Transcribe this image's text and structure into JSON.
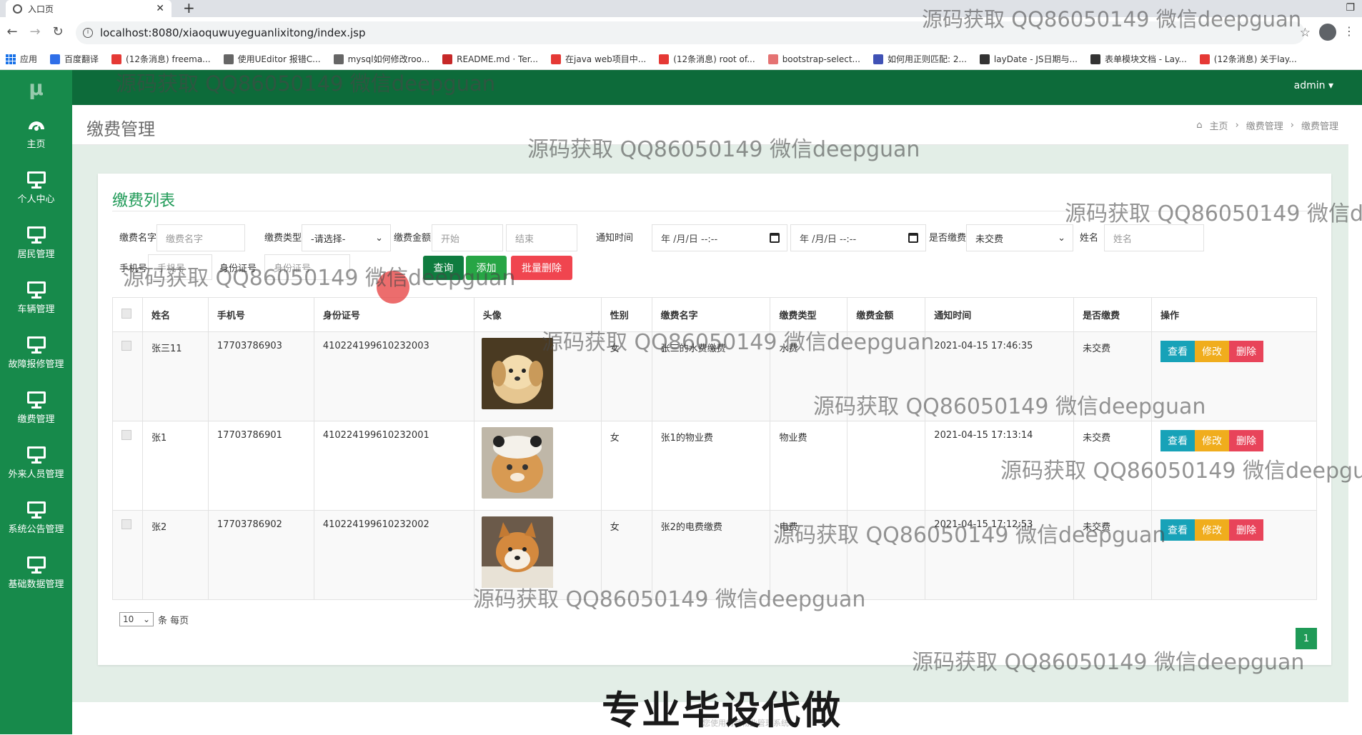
{
  "browser": {
    "tab_title": "入口页",
    "url": "localhost:8080/xiaoquwuyeguanlixitong/index.jsp",
    "bookmarks": [
      {
        "label": "应用",
        "color": "#1a73e8"
      },
      {
        "label": "百度翻译",
        "color": "#2f6fe8"
      },
      {
        "label": "(12条消息) freema...",
        "color": "#e53935"
      },
      {
        "label": "使用UEditor 报错C...",
        "color": "#666666"
      },
      {
        "label": "mysql如何修改roo...",
        "color": "#666666"
      },
      {
        "label": "README.md · Ter...",
        "color": "#c62828"
      },
      {
        "label": "在java web项目中...",
        "color": "#e53935"
      },
      {
        "label": "(12条消息) root of...",
        "color": "#e53935"
      },
      {
        "label": "bootstrap-select...",
        "color": "#e57373"
      },
      {
        "label": "如何用正则匹配: 2...",
        "color": "#3f51b5"
      },
      {
        "label": "layDate - JS日期与...",
        "color": "#333333"
      },
      {
        "label": "表单模块文档 - Lay...",
        "color": "#333333"
      },
      {
        "label": "(12条消息) 关于lay...",
        "color": "#e53935"
      }
    ]
  },
  "sidebar": {
    "logo": "μ",
    "items": [
      {
        "label": "主页",
        "icon": "dashboard-icon"
      },
      {
        "label": "个人中心",
        "icon": "monitor-icon"
      },
      {
        "label": "居民管理",
        "icon": "monitor-icon"
      },
      {
        "label": "车辆管理",
        "icon": "monitor-icon"
      },
      {
        "label": "故障报修管理",
        "icon": "monitor-icon"
      },
      {
        "label": "缴费管理",
        "icon": "monitor-icon"
      },
      {
        "label": "外来人员管理",
        "icon": "monitor-icon"
      },
      {
        "label": "系统公告管理",
        "icon": "monitor-icon"
      },
      {
        "label": "基础数据管理",
        "icon": "monitor-icon"
      }
    ]
  },
  "topbar": {
    "user": "admin ▾"
  },
  "page": {
    "title": "缴费管理",
    "breadcrumb": [
      "主页",
      "缴费管理",
      "缴费管理"
    ]
  },
  "card": {
    "title": "缴费列表"
  },
  "filters": {
    "name_label": "缴费名字",
    "name_placeholder": "缴费名字",
    "type_label": "缴费类型",
    "type_value": "-请选择-",
    "amount_label": "缴费金额",
    "amount_start": "开始",
    "amount_end": "结束",
    "time_label": "通知时间",
    "date_from": "年 /月/日 --:--",
    "date_to": "年 /月/日 --:--",
    "paid_label": "是否缴费",
    "paid_value": "未交费",
    "person_label": "姓名",
    "person_placeholder": "姓名",
    "phone_label": "手机号",
    "phone_placeholder": "手机号",
    "idcard_label": "身份证号",
    "idcard_placeholder": "身份证号"
  },
  "buttons": {
    "search": "查询",
    "add": "添加",
    "batch_delete": "批量删除"
  },
  "table": {
    "headers": [
      "姓名",
      "手机号",
      "身份证号",
      "头像",
      "性别",
      "缴费名字",
      "缴费类型",
      "缴费金额",
      "通知时间",
      "是否缴费",
      "操作"
    ],
    "rows": [
      {
        "name": "张三11",
        "phone": "17703786903",
        "idcard": "410224199610232003",
        "gender": "女",
        "fee_name": "张三的水费缴费",
        "fee_type": "水费",
        "amount": "",
        "notice_time": "2021-04-15 17:46:35",
        "paid": "未交费",
        "photo": "puppy"
      },
      {
        "name": "张1",
        "phone": "17703786901",
        "idcard": "410224199610232001",
        "gender": "女",
        "fee_name": "张1的物业费",
        "fee_type": "物业费",
        "amount": "",
        "notice_time": "2021-04-15 17:13:14",
        "paid": "未交费",
        "photo": "cat"
      },
      {
        "name": "张2",
        "phone": "17703786902",
        "idcard": "410224199610232002",
        "gender": "女",
        "fee_name": "张2的电费缴费",
        "fee_type": "电费",
        "amount": "",
        "notice_time": "2021-04-15 17:12:53",
        "paid": "未交费",
        "photo": "shiba"
      }
    ],
    "actions": {
      "view": "查看",
      "edit": "修改",
      "delete": "删除"
    }
  },
  "pagination": {
    "page_size": "10",
    "per_page_label": "条 每页",
    "current_page": "1"
  },
  "footer": "您使用的是物业管理系统",
  "watermark": "源码获取 QQ86050149 微信deepguan",
  "banner": "专业毕设代做",
  "colors": {
    "sidebar": "#178a4b",
    "topbar": "#0d6b3a",
    "accent": "#1f9a57",
    "view": "#17a2b8",
    "edit": "#f0ad1d",
    "delete": "#e8445a",
    "batch_delete": "#f0454f"
  }
}
